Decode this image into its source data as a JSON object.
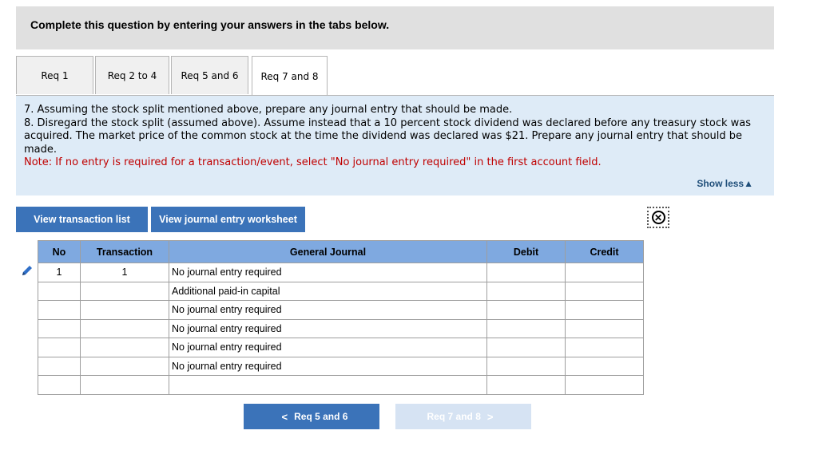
{
  "header": {
    "title": "Complete this question by entering your answers in the tabs below."
  },
  "tabs": [
    {
      "label": "Req 1"
    },
    {
      "label": "Req 2 to 4"
    },
    {
      "label": "Req 5 and 6"
    },
    {
      "label": "Req 7 and 8",
      "active": true
    }
  ],
  "question": {
    "line1": "7. Assuming the stock split mentioned above, prepare any journal entry that should be made.",
    "line2": "8. Disregard the stock split (assumed above). Assume instead that a 10 percent stock dividend was declared before any treasury stock was acquired. The market price of the common stock at the time the dividend was declared was $21. Prepare any journal entry that should be made.",
    "note": "Note: If no entry is required for a transaction/event, select \"No journal entry required\" in the first account field.",
    "show_less": "Show less"
  },
  "buttons": {
    "view_transactions": "View transaction list",
    "view_worksheet": "View journal entry worksheet"
  },
  "journal": {
    "headers": {
      "no": "No",
      "transaction": "Transaction",
      "account": "General Journal",
      "debit": "Debit",
      "credit": "Credit"
    },
    "rows": [
      {
        "no": "1",
        "transaction": "1",
        "account": "No journal entry required",
        "debit": "",
        "credit": ""
      },
      {
        "no": "",
        "transaction": "",
        "account": "Additional paid-in capital",
        "debit": "",
        "credit": ""
      },
      {
        "no": "",
        "transaction": "",
        "account": "No journal entry required",
        "debit": "",
        "credit": ""
      },
      {
        "no": "",
        "transaction": "",
        "account": "No journal entry required",
        "debit": "",
        "credit": ""
      },
      {
        "no": "",
        "transaction": "",
        "account": "No journal entry required",
        "debit": "",
        "credit": ""
      },
      {
        "no": "",
        "transaction": "",
        "account": "No journal entry required",
        "debit": "",
        "credit": ""
      },
      {
        "no": "",
        "transaction": "",
        "account": "",
        "debit": "",
        "credit": ""
      }
    ]
  },
  "navigation": {
    "prev_label": "Req 5 and 6",
    "next_label": "Req 7 and 8"
  },
  "colors": {
    "accent": "#3b73b9",
    "table_header": "#7fa9e0",
    "info_bg": "#deebf7",
    "note": "#c00000"
  }
}
